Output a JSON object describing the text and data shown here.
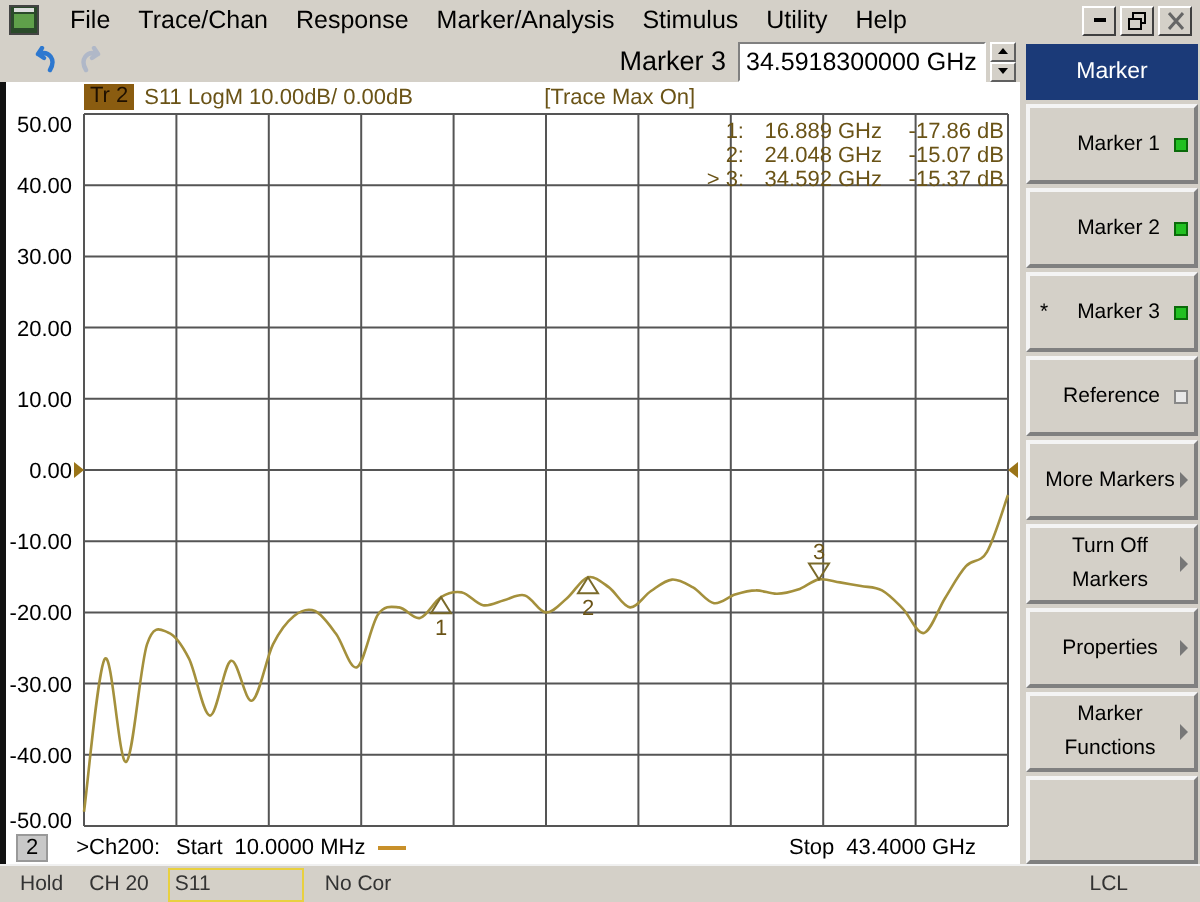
{
  "menu": [
    "File",
    "Trace/Chan",
    "Response",
    "Marker/Analysis",
    "Stimulus",
    "Utility",
    "Help"
  ],
  "toolbar": {
    "buttons": [
      {
        "kind": "undo",
        "disabled": false
      },
      {
        "kind": "redo",
        "disabled": true
      }
    ],
    "entry_label": "Marker 3",
    "entry_value": "34.5918300000 GHz"
  },
  "trace": {
    "badge": "Tr 2",
    "description": "S11 LogM 10.00dB/ 0.00dB",
    "status": "[Trace Max On]"
  },
  "marker_readout": [
    {
      "index": "1:",
      "frequency": "16.889 GHz",
      "value": "-17.86 dB",
      "active": false
    },
    {
      "index": "2:",
      "frequency": "24.048 GHz",
      "value": "-15.07 dB",
      "active": false
    },
    {
      "index": "> 3:",
      "frequency": "34.592 GHz",
      "value": "-15.37 dB",
      "active": true
    }
  ],
  "chart_data": {
    "type": "line",
    "ylim": [
      -50,
      50
    ],
    "yticks": [
      {
        "value": 50,
        "label": "50.00"
      },
      {
        "value": 40,
        "label": "40.00"
      },
      {
        "value": 30,
        "label": "30.00"
      },
      {
        "value": 20,
        "label": "20.00"
      },
      {
        "value": 10,
        "label": "10.00"
      },
      {
        "value": 0,
        "label": "0.00"
      },
      {
        "value": -10,
        "label": "-10.00"
      },
      {
        "value": -20,
        "label": "-20.00"
      },
      {
        "value": -30,
        "label": "-30.00"
      },
      {
        "value": -40,
        "label": "-40.00"
      },
      {
        "value": -50,
        "label": "-50.00"
      }
    ],
    "categories": [
      null,
      null,
      null,
      null,
      null,
      null,
      null,
      null,
      null,
      null,
      null,
      null,
      null,
      null,
      null,
      null,
      null,
      null,
      null,
      null,
      null,
      null,
      null,
      null,
      null,
      null,
      null,
      null,
      null,
      null,
      null,
      null,
      null,
      null,
      null,
      null,
      null,
      null,
      null,
      null,
      null,
      null,
      null,
      null,
      null
    ],
    "grid": true,
    "series": [
      {
        "color": "#a4903c",
        "values": [
          -48,
          -26.5,
          -41,
          -24.5,
          -22.8,
          -26.5,
          -34.5,
          -26.8,
          -32.4,
          -24.5,
          -20.5,
          -19.8,
          -23,
          -27.7,
          -20.3,
          -19.3,
          -20.8,
          -17.86,
          -17.2,
          -19,
          -18.3,
          -17.6,
          -20,
          -18,
          -15.07,
          -16.5,
          -19.3,
          -17,
          -15.4,
          -16.5,
          -18.7,
          -17.5,
          -16.9,
          -17.4,
          -16.8,
          -15.37,
          -15.8,
          -16.3,
          -16.9,
          -19.5,
          -22.9,
          -18,
          -13.5,
          -11.5,
          -3.5
        ]
      }
    ],
    "annotations": [
      {
        "y": -17.86,
        "text": "1"
      },
      {
        "y": -15.07,
        "text": "2"
      },
      {
        "y": -15.37,
        "text": "3"
      }
    ]
  },
  "channel_bar": {
    "number": "2",
    "channel": ">Ch200:",
    "start_label": "Start",
    "start_value": "10.0000 MHz",
    "stop_label": "Stop",
    "stop_value": "43.4000 GHz"
  },
  "softkeys": {
    "title": "Marker",
    "items": [
      {
        "kind": "indicator",
        "label": "Marker 1",
        "on": true
      },
      {
        "kind": "indicator",
        "label": "Marker 2",
        "on": true
      },
      {
        "kind": "indicator",
        "label": "Marker 3",
        "on": true,
        "prefix": "*"
      },
      {
        "kind": "indicator",
        "label": "Reference",
        "on": false
      },
      {
        "kind": "submenu",
        "label": "More Markers"
      },
      {
        "kind": "submenu",
        "label": "Turn Off\nMarkers"
      },
      {
        "kind": "submenu",
        "label": "Properties"
      },
      {
        "kind": "submenu",
        "label": "Marker\nFunctions"
      },
      {
        "kind": "blank"
      }
    ]
  },
  "status_bar": {
    "items": [
      {
        "text": "Hold",
        "highlighted": false
      },
      {
        "text": "CH 20",
        "highlighted": false
      },
      {
        "text": "S11",
        "highlighted": true
      },
      {
        "text": "No Cor",
        "highlighted": false
      }
    ],
    "right": "LCL"
  }
}
